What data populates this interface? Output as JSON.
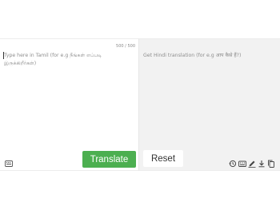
{
  "source": {
    "char_count": "500 / 500",
    "placeholder": "Type here in Tamil (for e.g நீங்கள் எப்படி இருக்கிறீர்கள்)"
  },
  "output": {
    "placeholder": "Get Hindi translation (for e.g आप कैसे हैं?)"
  },
  "buttons": {
    "translate": "Translate",
    "reset": "Reset"
  },
  "icons": {
    "left": "keyboard-icon",
    "right": [
      "history-icon",
      "keyboard-icon",
      "edit-icon",
      "download-icon",
      "copy-icon"
    ]
  }
}
